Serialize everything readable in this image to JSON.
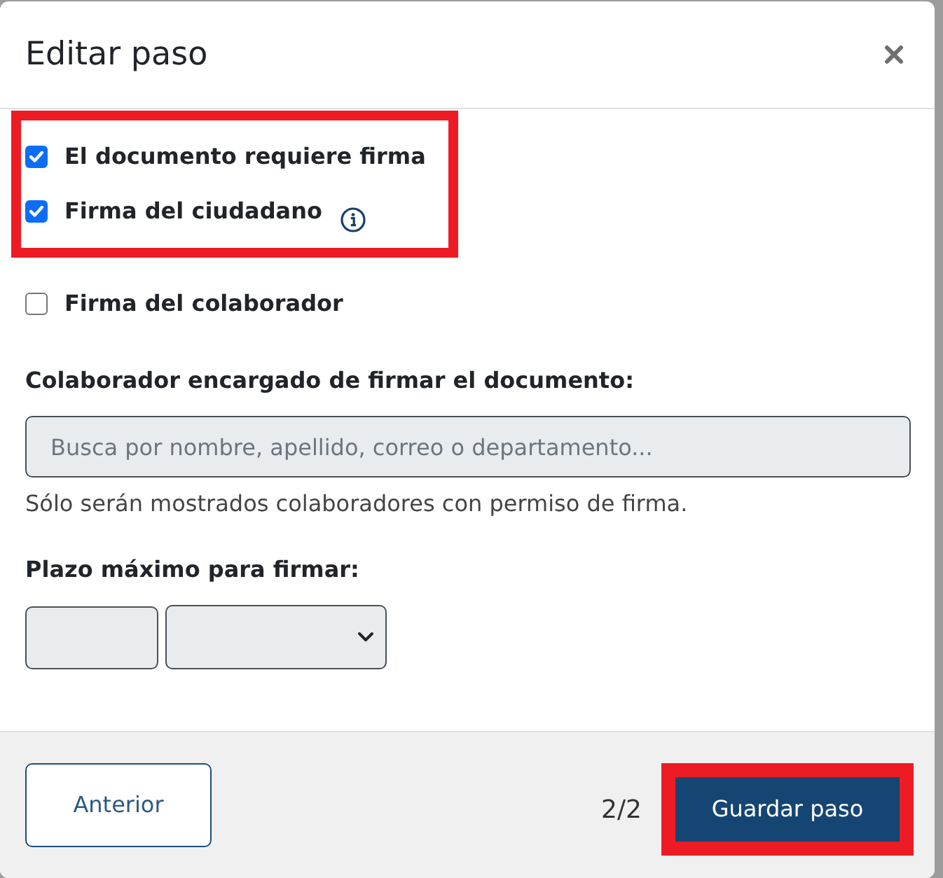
{
  "dialog": {
    "title": "Editar paso"
  },
  "checkbox_groups": [
    {
      "highlighted": true,
      "items": [
        {
          "label": "El documento requiere firma",
          "checked": true,
          "info": false
        },
        {
          "label": "Firma del ciudadano",
          "checked": true,
          "info": true
        }
      ]
    },
    {
      "highlighted": false,
      "items": [
        {
          "label": "Firma del colaborador",
          "checked": false,
          "info": false
        }
      ]
    }
  ],
  "signer": {
    "label": "Colaborador encargado de firmar el documento:",
    "placeholder": "Busca por nombre, apellido, correo o departamento...",
    "help": "Sólo serán mostrados colaboradores con permiso de firma."
  },
  "deadline": {
    "label": "Plazo máximo para firmar:"
  },
  "footer": {
    "back_button": "Anterior",
    "step": "2/2",
    "save_button": {
      "label": "Guardar paso",
      "highlighted": true
    }
  }
}
